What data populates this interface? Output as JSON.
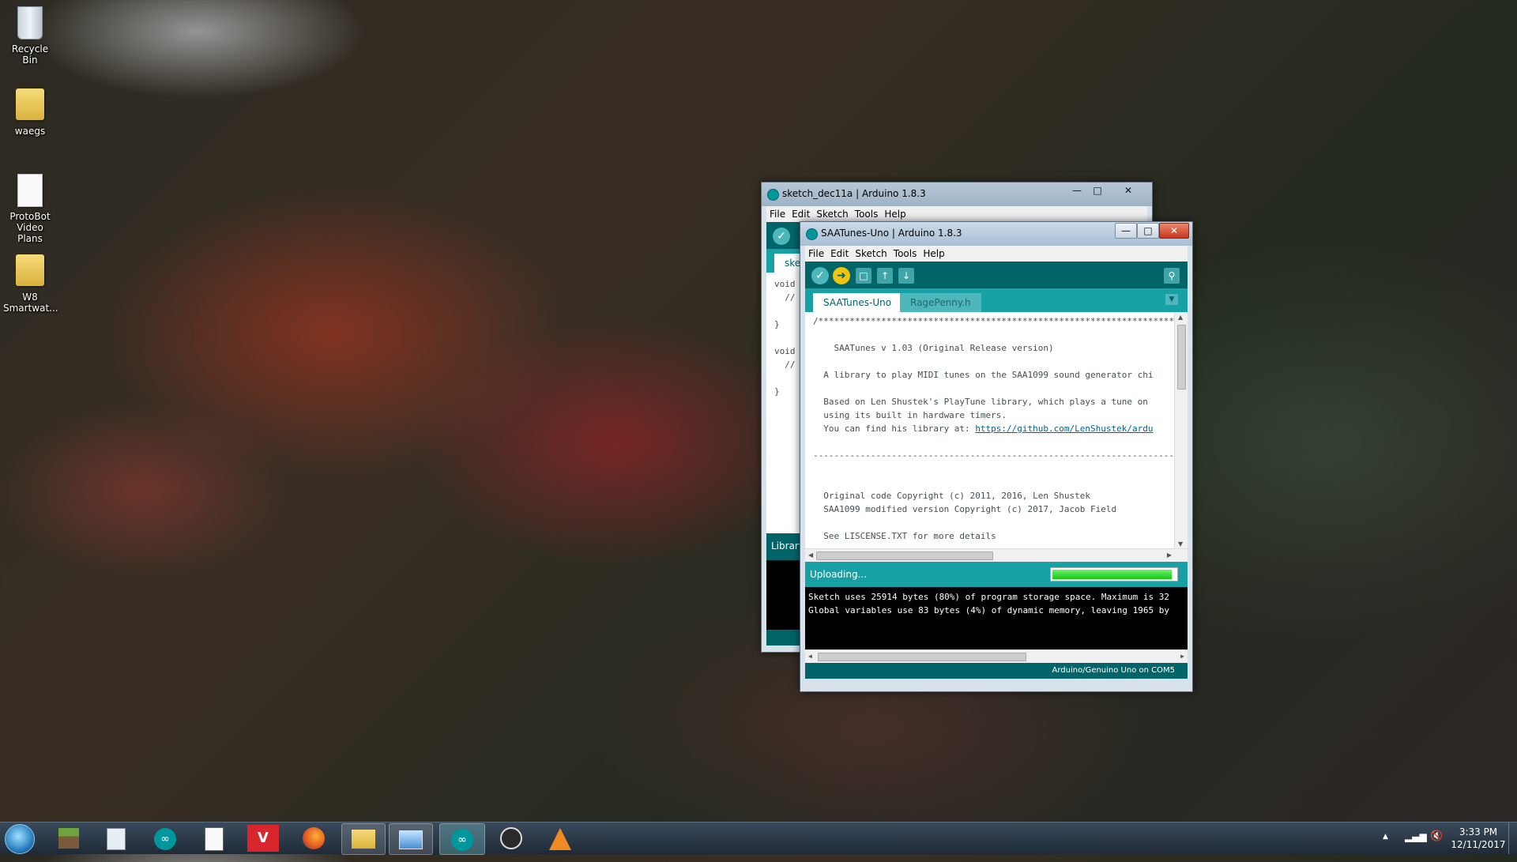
{
  "desktop": {
    "icons": [
      {
        "label": "Recycle Bin"
      },
      {
        "label": "waegs"
      },
      {
        "label": "ProtoBot Video Plans"
      },
      {
        "label": "W8 Smartwat..."
      }
    ]
  },
  "back_window": {
    "title": "sketch_dec11a | Arduino 1.8.3",
    "menu": [
      "File",
      "Edit",
      "Sketch",
      "Tools",
      "Help"
    ],
    "tab_label": "sket",
    "code_lines": [
      "void",
      "  //",
      "",
      "}",
      "",
      "void",
      "  //",
      "",
      "}"
    ],
    "status_label": "Library"
  },
  "front_window": {
    "title": "SAATunes-Uno | Arduino 1.8.3",
    "menu": [
      "File",
      "Edit",
      "Sketch",
      "Tools",
      "Help"
    ],
    "tabs": [
      {
        "label": "SAATunes-Uno",
        "active": true
      },
      {
        "label": "RagePenny.h",
        "active": false
      }
    ],
    "code": {
      "line1": "/*************************************************************************",
      "line3": "    SAATunes v 1.03 (Original Release version)",
      "line5": "  A library to play MIDI tunes on the SAA1099 sound generator chi",
      "line7": "  Based on Len Shustek's PlayTune library, which plays a tune on",
      "line8": "  using its built in hardware timers.",
      "line9_prefix": "  You can find his library at: ",
      "line9_link": "https://github.com/LenShustek/ardu",
      "line11": "--------------------------------------------------------------------------",
      "line14": "  Original code Copyright (c) 2011, 2016, Len Shustek",
      "line15": "  SAA1099 modified version Copyright (c) 2017, Jacob Field",
      "line17": "  See LISCENSE.TXT for more details",
      "line19": "**************************************************************************"
    },
    "status": {
      "text": "Uploading...",
      "progress": 0.97
    },
    "console": [
      "Sketch uses 25914 bytes (80%) of program storage space. Maximum is 32",
      "Global variables use 83 bytes (4%) of dynamic memory, leaving 1965 by"
    ],
    "board": "Arduino/Genuino Uno on COM5",
    "accent_color": "#00979c"
  },
  "taskbar": {
    "apps": [
      "minecraft-icon",
      "paint-icon",
      "arduino-icon",
      "document-icon",
      "vivaldi-icon",
      "firefox-icon",
      "explorer-icon",
      "remote-desktop-icon",
      "arduino-icon",
      "obs-icon",
      "vlc-icon"
    ],
    "clock_time": "3:33 PM",
    "clock_date": "12/11/2017"
  }
}
